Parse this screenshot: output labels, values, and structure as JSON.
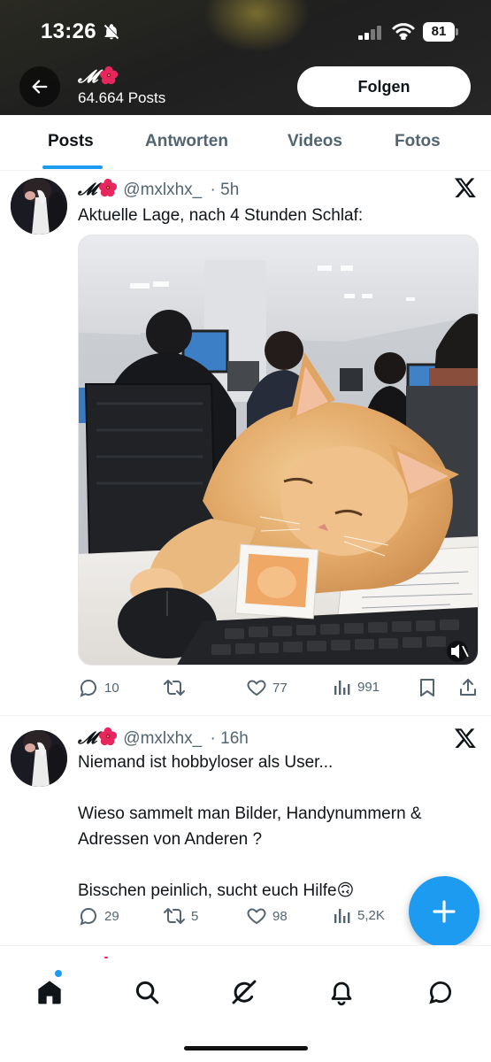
{
  "status_bar": {
    "time": "13:26",
    "battery": "81"
  },
  "profile": {
    "name": "𝓜",
    "post_count": "64.664 Posts",
    "follow_label": "Folgen"
  },
  "tabs": [
    "Posts",
    "Antworten",
    "Videos",
    "Fotos"
  ],
  "active_tab": "Posts",
  "posts": [
    {
      "name": "𝓜",
      "handle": "@mxlxhx_",
      "time": "· 5h",
      "text": "Aktuelle Lage, nach 4 Stunden Schlaf:",
      "media": "photo of a sleeping cat at an office desk",
      "replies": "10",
      "reposts": "",
      "likes": "77",
      "views": "991"
    },
    {
      "name": "𝓜",
      "handle": "@mxlxhx_",
      "time": "· 16h",
      "text_lines": [
        "Niemand ist hobbyloser als User...",
        "",
        "Wieso sammelt man Bilder, Handynummern &",
        "Adressen von Anderen ?",
        "",
        "Bisschen peinlich, sucht euch Hilfe🙃"
      ],
      "replies": "29",
      "reposts": "5",
      "likes": "98",
      "views": "5,2K"
    }
  ],
  "colors": {
    "accent": "#1d9bf0",
    "text": "#0f1419",
    "muted": "#536471",
    "header_bg": "#1f1f1f"
  }
}
